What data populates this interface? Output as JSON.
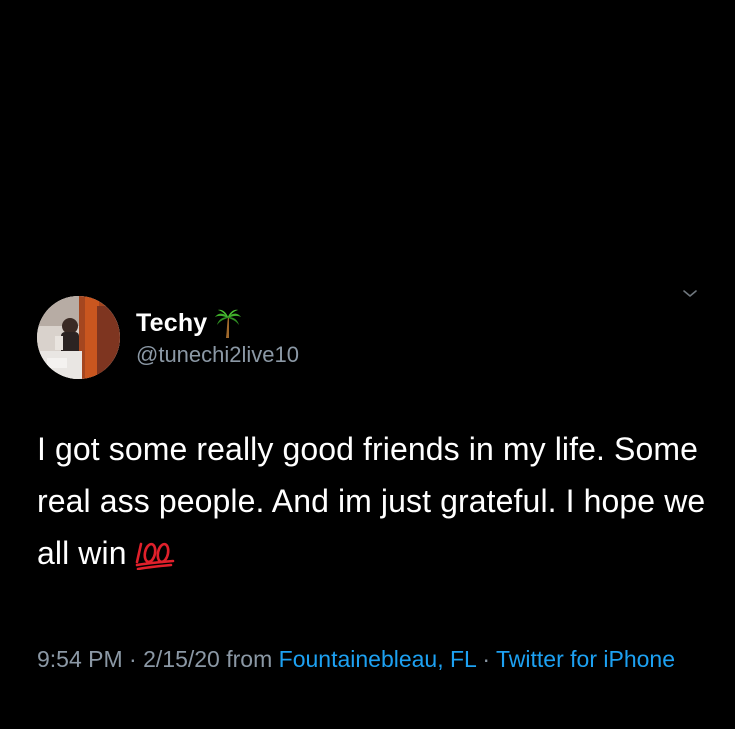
{
  "tweet": {
    "display_name": "Techy",
    "display_name_emoji": "palm-tree-icon",
    "handle": "@tunechi2live10",
    "text": "I got some really good friends in my life. Some real ass people. And im just grateful. I hope we all win",
    "text_emoji": "hundred-points-icon",
    "time": "9:54 PM",
    "separator": " · ",
    "date": "2/15/20",
    "from_label": " from ",
    "location": "Fountainebleau, FL",
    "source": "Twitter for iPhone"
  },
  "colors": {
    "background": "#000000",
    "text_primary": "#ffffff",
    "text_secondary": "#8b98a5",
    "link": "#1da1f2",
    "hundred_emoji": "#e0202b"
  },
  "icons": {
    "chevron": "chevron-down-icon",
    "avatar": "avatar"
  }
}
